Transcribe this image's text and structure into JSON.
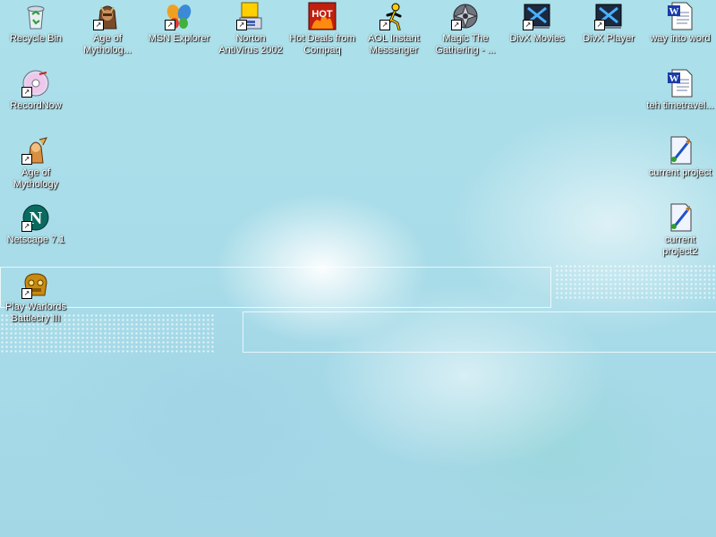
{
  "desktop": {
    "icons": [
      {
        "label": "Recycle Bin",
        "icon": "recycle-bin-icon"
      },
      {
        "label": "Age of Mytholog...",
        "icon": "age-of-mythology-icon"
      },
      {
        "label": "MSN Explorer",
        "icon": "msn-butterfly-icon"
      },
      {
        "label": "Norton AntiVirus 2002",
        "icon": "norton-antivirus-icon"
      },
      {
        "label": "Hot Deals from Compaq",
        "icon": "hot-deals-icon",
        "badge": "HOT"
      },
      {
        "label": "AOL Instant Messenger",
        "icon": "aim-running-man-icon"
      },
      {
        "label": "Magic The Gathering - ...",
        "icon": "magic-the-gathering-icon"
      },
      {
        "label": "DivX Movies",
        "icon": "divx-icon"
      },
      {
        "label": "DivX Player",
        "icon": "divx-icon"
      },
      {
        "label": "way into word",
        "icon": "word-document-icon"
      },
      {
        "label": "RecordNow",
        "icon": "cd-disc-icon"
      },
      {
        "label": "teh timetravel...",
        "icon": "word-document-icon"
      },
      {
        "label": "Age of Mythology",
        "icon": "age-of-mythology-icon"
      },
      {
        "label": "current project",
        "icon": "paint-file-icon"
      },
      {
        "label": "Netscape 7.1",
        "icon": "netscape-icon",
        "badge": "N"
      },
      {
        "label": "current project2",
        "icon": "paint-file-icon"
      },
      {
        "label": "Play Warlords Battlecry III",
        "icon": "warlords-battlecry-icon"
      }
    ]
  },
  "colors": {
    "desktop_background": "#a9dbe8",
    "label_text": "#ffffff",
    "label_shadow": "#000000"
  }
}
